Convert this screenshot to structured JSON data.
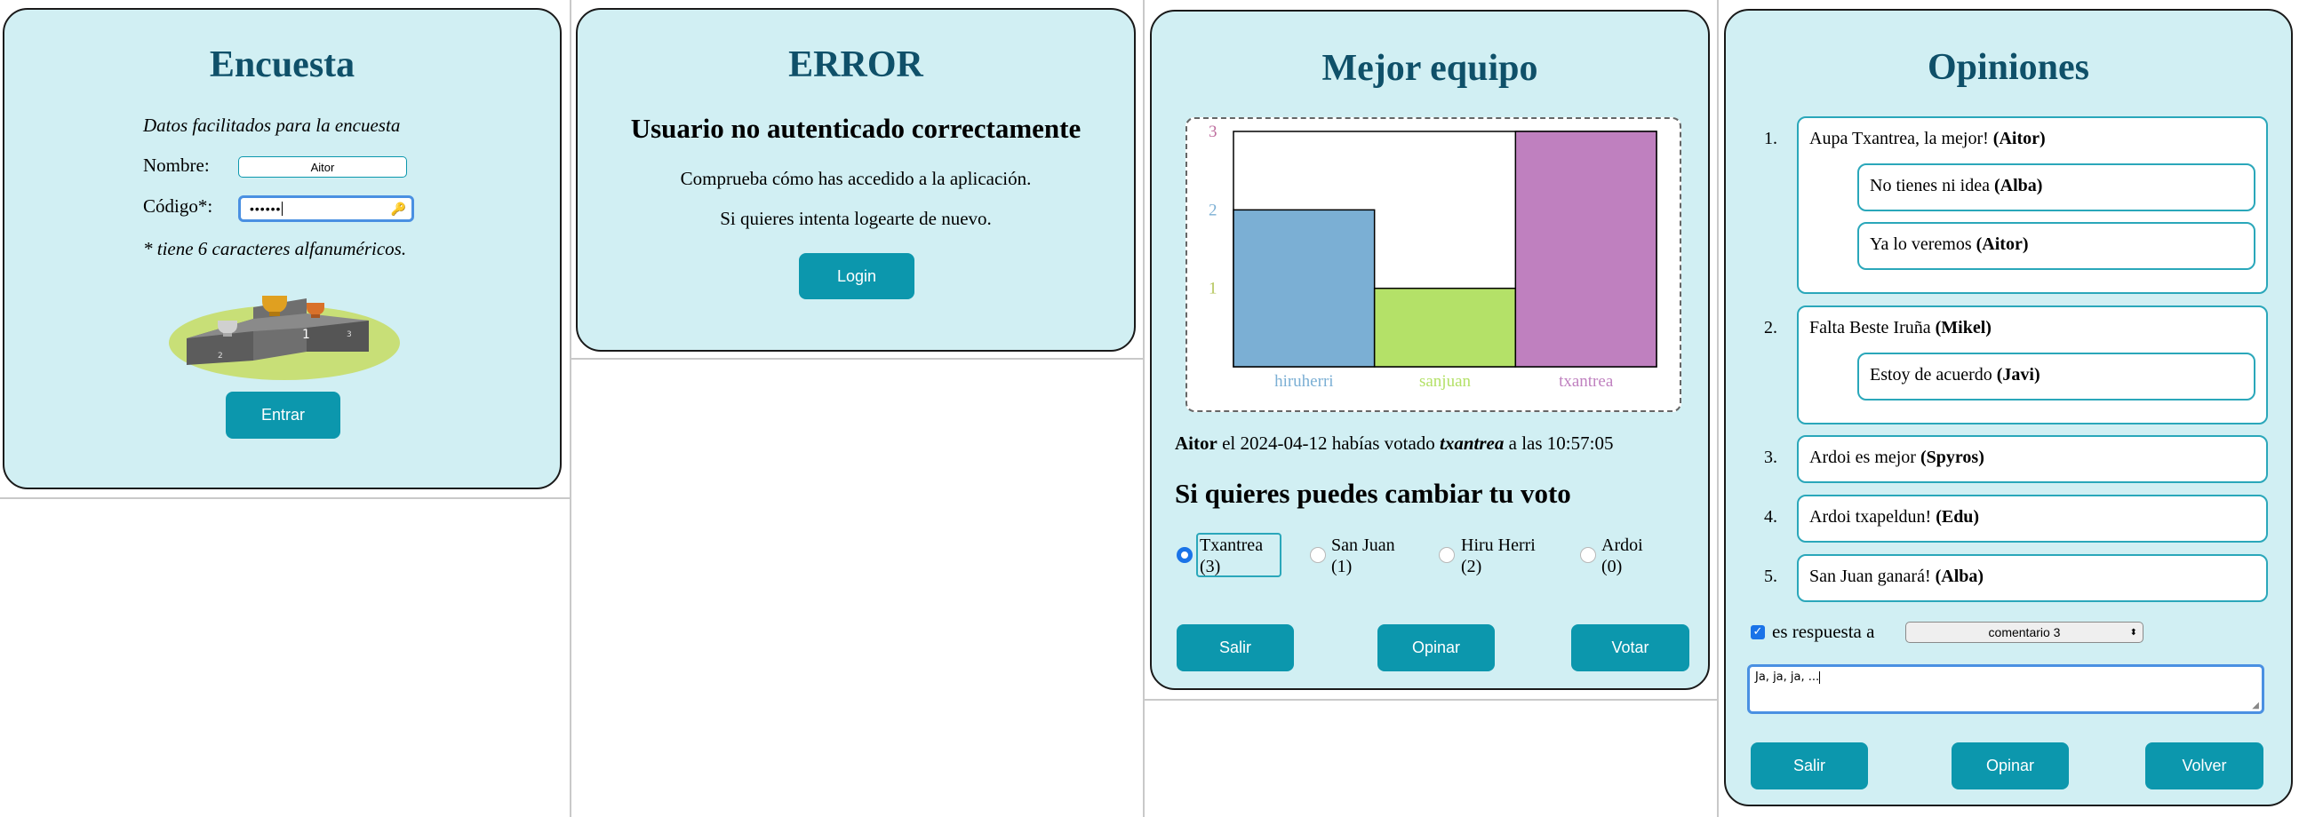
{
  "login": {
    "title": "Encuesta",
    "subtitle": "Datos facilitados para la encuesta",
    "name_label": "Nombre:",
    "name_value": "Aitor",
    "code_label": "Código*:",
    "code_value": "••••••",
    "note": "* tiene 6 caracteres alfanuméricos.",
    "enter_button": "Entrar"
  },
  "error": {
    "title": "ERROR",
    "heading": "Usuario no autenticado correctamente",
    "line1": "Comprueba cómo has accedido a la aplicación.",
    "line2": "Si quieres intenta logearte de nuevo.",
    "login_button": "Login"
  },
  "vote": {
    "title": "Mejor equipo",
    "info_user": "Aitor",
    "info_mid": "el 2024-04-12 habías votado",
    "info_team": "txantrea",
    "info_end": "a las 10:57:05",
    "change_heading": "Si quieres puedes cambiar tu voto",
    "options": [
      {
        "name": "Txantrea",
        "count": "(3)",
        "selected": true
      },
      {
        "name": "San Juan",
        "count": "(1)",
        "selected": false
      },
      {
        "name": "Hiru Herri",
        "count": "(2)",
        "selected": false
      },
      {
        "name": "Ardoi",
        "count": "(0)",
        "selected": false
      }
    ],
    "exit_button": "Salir",
    "opine_button": "Opinar",
    "vote_button": "Votar"
  },
  "chart_data": {
    "type": "bar",
    "categories": [
      "hiruherri",
      "sanjuan",
      "txantrea"
    ],
    "values": [
      2,
      1,
      3
    ],
    "ylim": [
      0,
      3
    ],
    "yticks": [
      "1",
      "2",
      "3"
    ],
    "colors": [
      "#7bafd4",
      "#b4e168",
      "#bf80bf"
    ],
    "tick_colors": [
      "#b4c55a",
      "#7bafd4",
      "#bf6f9f"
    ],
    "grid": false
  },
  "opinions": {
    "title": "Opiniones",
    "items": [
      {
        "num": "1.",
        "text": "Aupa Txantrea, la mejor!",
        "author": "(Aitor)"
      },
      {
        "num": "",
        "text": "No tienes ni idea",
        "author": "(Alba)"
      },
      {
        "num": "",
        "text": "Ya lo veremos",
        "author": "(Aitor)"
      },
      {
        "num": "2.",
        "text": "Falta Beste Iruña",
        "author": "(Mikel)"
      },
      {
        "num": "",
        "text": "Estoy de acuerdo",
        "author": "(Javi)"
      },
      {
        "num": "3.",
        "text": "Ardoi es mejor",
        "author": "(Spyros)"
      },
      {
        "num": "4.",
        "text": "Ardoi txapeldun!",
        "author": "(Edu)"
      },
      {
        "num": "5.",
        "text": "San Juan ganará!",
        "author": "(Alba)"
      }
    ],
    "reply_label": "es respuesta a",
    "reply_checked": true,
    "reply_select": "comentario 3",
    "comment_value": "Ja, ja, ja, ...",
    "exit_button": "Salir",
    "opine_button": "Opinar",
    "back_button": "Volver"
  }
}
